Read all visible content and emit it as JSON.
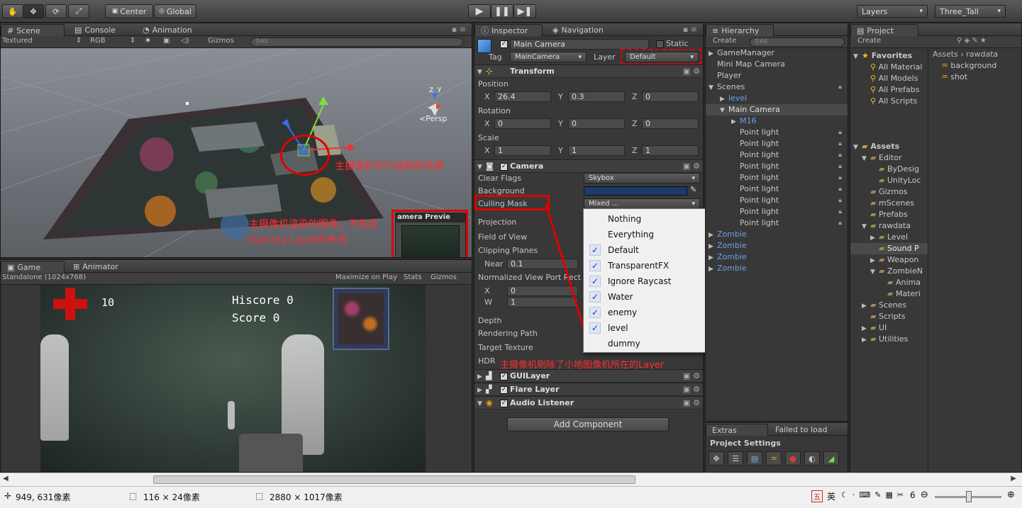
{
  "toolbar": {
    "pivot": "Center",
    "space": "Global",
    "layers": "Layers",
    "layout": "Three_Tall"
  },
  "scene": {
    "tabs": [
      "Scene",
      "Console",
      "Animation"
    ],
    "render_mode": "Textured",
    "color_mode": "RGB",
    "gizmos": "Gizmos",
    "search_placeholder": "All",
    "persp": "<Persp",
    "preview_title": "amera Previe",
    "annotation1": "主摄像机平行地照射场景",
    "annotation2": "主摄像机渲染的图像，不包含dummy Layer的东西"
  },
  "game": {
    "tabs": [
      "Game",
      "Animator"
    ],
    "resolution": "Standalone (1024x768)",
    "maximize": "Maximize on Play",
    "stats": "Stats",
    "gizmos": "Gizmos",
    "health": "10",
    "hiscore": "Hiscore 0",
    "score": "Score 0"
  },
  "inspector": {
    "tabs": [
      "Inspector",
      "Navigation"
    ],
    "object_name": "Main Camera",
    "static": "Static",
    "tag_label": "Tag",
    "tag_value": "MainCamera",
    "layer_label": "Layer",
    "layer_value": "Default",
    "transform": "Transform",
    "position_label": "Position",
    "position": {
      "x": "26.4",
      "y": "0.3",
      "z": "0"
    },
    "rotation_label": "Rotation",
    "rotation": {
      "x": "0",
      "y": "0",
      "z": "0"
    },
    "scale_label": "Scale",
    "scale": {
      "x": "1",
      "y": "1",
      "z": "1"
    },
    "camera": "Camera",
    "clear_flags_label": "Clear Flags",
    "clear_flags": "Skybox",
    "background_label": "Background",
    "culling_mask_label": "Culling Mask",
    "culling_mask": "Mixed ...",
    "projection": "Projection",
    "fov": "Field of View",
    "clipping": "Clipping Planes",
    "near_label": "Near",
    "near": "0.1",
    "viewport": "Normalized View Port Rect",
    "vp_x": "0",
    "vp_w": "1",
    "depth": "Depth",
    "rendering_path": "Rendering Path",
    "target_texture": "Target Texture",
    "hdr": "HDR",
    "annotation3": "主摄像机剔除了小地图像机所在的Layer",
    "guilayer": "GUILayer",
    "flare": "Flare Layer",
    "audio": "Audio Listener",
    "add_component": "Add Component"
  },
  "culling_popup": [
    {
      "label": "Nothing",
      "checked": false
    },
    {
      "label": "Everything",
      "checked": false
    },
    {
      "label": "Default",
      "checked": true
    },
    {
      "label": "TransparentFX",
      "checked": true
    },
    {
      "label": "Ignore Raycast",
      "checked": true
    },
    {
      "label": "Water",
      "checked": true
    },
    {
      "label": "enemy",
      "checked": true
    },
    {
      "label": "level",
      "checked": true
    },
    {
      "label": "dummy",
      "checked": false
    }
  ],
  "hierarchy": {
    "tab": "Hierarchy",
    "create": "Create",
    "search_placeholder": "All",
    "items": [
      {
        "label": "GameManager",
        "indent": 0,
        "arrow": "▶",
        "color": "#c8c8c8",
        "lock": false
      },
      {
        "label": "Mini Map Camera",
        "indent": 0,
        "arrow": "",
        "color": "#c8c8c8",
        "lock": false
      },
      {
        "label": "Player",
        "indent": 0,
        "arrow": "",
        "color": "#c8c8c8",
        "lock": false
      },
      {
        "label": "Scenes",
        "indent": 0,
        "arrow": "▼",
        "color": "#c8c8c8",
        "lock": true
      },
      {
        "label": "level",
        "indent": 1,
        "arrow": "▶",
        "color": "#6aa0e8",
        "lock": false
      },
      {
        "label": "Main Camera",
        "indent": 1,
        "arrow": "▼",
        "color": "#e0e0e0",
        "lock": false,
        "selected": true
      },
      {
        "label": "M16",
        "indent": 2,
        "arrow": "▶",
        "color": "#6aa0e8",
        "lock": false
      },
      {
        "label": "Point light",
        "indent": 2,
        "arrow": "",
        "color": "#c8c8c8",
        "lock": true
      },
      {
        "label": "Point light",
        "indent": 2,
        "arrow": "",
        "color": "#c8c8c8",
        "lock": true
      },
      {
        "label": "Point light",
        "indent": 2,
        "arrow": "",
        "color": "#c8c8c8",
        "lock": true
      },
      {
        "label": "Point light",
        "indent": 2,
        "arrow": "",
        "color": "#c8c8c8",
        "lock": true
      },
      {
        "label": "Point light",
        "indent": 2,
        "arrow": "",
        "color": "#c8c8c8",
        "lock": true
      },
      {
        "label": "Point light",
        "indent": 2,
        "arrow": "",
        "color": "#c8c8c8",
        "lock": true
      },
      {
        "label": "Point light",
        "indent": 2,
        "arrow": "",
        "color": "#c8c8c8",
        "lock": true
      },
      {
        "label": "Point light",
        "indent": 2,
        "arrow": "",
        "color": "#c8c8c8",
        "lock": true
      },
      {
        "label": "Point light",
        "indent": 2,
        "arrow": "",
        "color": "#c8c8c8",
        "lock": true
      },
      {
        "label": "Zombie",
        "indent": 0,
        "arrow": "▶",
        "color": "#6aa0e8",
        "lock": false
      },
      {
        "label": "Zombie",
        "indent": 0,
        "arrow": "▶",
        "color": "#6aa0e8",
        "lock": false
      },
      {
        "label": "Zombie",
        "indent": 0,
        "arrow": "▶",
        "color": "#6aa0e8",
        "lock": false
      },
      {
        "label": "Zombie",
        "indent": 0,
        "arrow": "▶",
        "color": "#6aa0e8",
        "lock": false
      }
    ],
    "extras_tab": "Extras",
    "failed_tab": "Failed to load",
    "project_settings": "Project Settings"
  },
  "project": {
    "tab": "Project",
    "create": "Create",
    "favorites": "Favorites",
    "fav_items": [
      "All Material",
      "All Models",
      "All Prefabs",
      "All Scripts"
    ],
    "assets_root": "Assets",
    "breadcrumb_assets": "Assets",
    "breadcrumb_sep": "›",
    "breadcrumb_folder": "rawdata",
    "tree": [
      {
        "label": "Editor",
        "indent": 1,
        "arrow": "▼"
      },
      {
        "label": "ByDesig",
        "indent": 2,
        "arrow": ""
      },
      {
        "label": "UnityLoc",
        "indent": 2,
        "arrow": ""
      },
      {
        "label": "Gizmos",
        "indent": 1,
        "arrow": ""
      },
      {
        "label": "mScenes",
        "indent": 1,
        "arrow": ""
      },
      {
        "label": "Prefabs",
        "indent": 1,
        "arrow": ""
      },
      {
        "label": "rawdata",
        "indent": 1,
        "arrow": "▼"
      },
      {
        "label": "Level",
        "indent": 2,
        "arrow": "▶"
      },
      {
        "label": "Sound P",
        "indent": 2,
        "arrow": "",
        "selected": true
      },
      {
        "label": "Weapon",
        "indent": 2,
        "arrow": "▶"
      },
      {
        "label": "ZombieN",
        "indent": 2,
        "arrow": "▼"
      },
      {
        "label": "Anima",
        "indent": 3,
        "arrow": ""
      },
      {
        "label": "Materi",
        "indent": 3,
        "arrow": ""
      },
      {
        "label": "Scenes",
        "indent": 1,
        "arrow": "▶"
      },
      {
        "label": "Scripts",
        "indent": 1,
        "arrow": ""
      },
      {
        "label": "UI",
        "indent": 1,
        "arrow": "▶"
      },
      {
        "label": "Utilities",
        "indent": 1,
        "arrow": "▶"
      }
    ],
    "files": [
      "background",
      "shot"
    ]
  },
  "status": {
    "cursor": "949, 631像素",
    "selection": "116 × 24像素",
    "image_size": "2880 × 1017像素",
    "ime1": "英",
    "zoom_val": "6"
  }
}
